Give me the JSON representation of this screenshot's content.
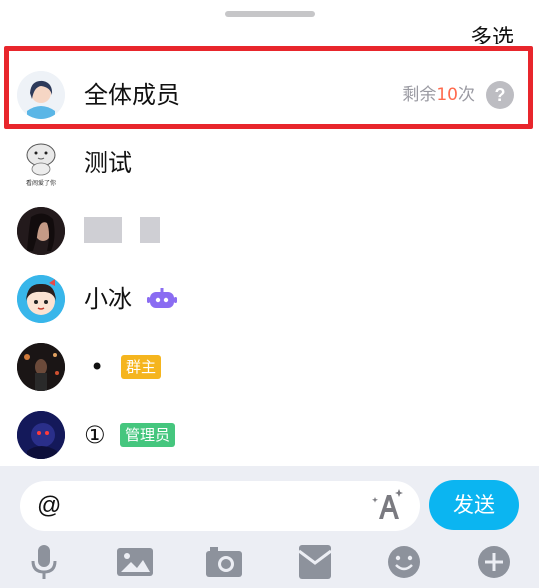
{
  "header": {
    "multi_select_label": "多选"
  },
  "members": [
    {
      "name": "全体成员",
      "remaining_prefix": "剩余",
      "remaining_count": "10",
      "remaining_suffix": "次",
      "help_icon": "?"
    },
    {
      "name": "测试",
      "avatar_caption": "看闹爱了你"
    },
    {
      "name": ""
    },
    {
      "name": "小冰"
    },
    {
      "name": "•",
      "role": "群主"
    },
    {
      "name": "①",
      "role": "管理员"
    }
  ],
  "composer": {
    "input_value": "@",
    "send_label": "发送"
  },
  "toolbar": {
    "icons": [
      "microphone-icon",
      "image-icon",
      "camera-icon",
      "red-packet-icon",
      "emoji-icon",
      "plus-icon"
    ]
  },
  "colors": {
    "highlight": "#e8262c",
    "send": "#0bb5f1",
    "owner_badge": "#f5b51e",
    "admin_badge": "#45c67e",
    "remaining_count": "#ff6a4d"
  }
}
